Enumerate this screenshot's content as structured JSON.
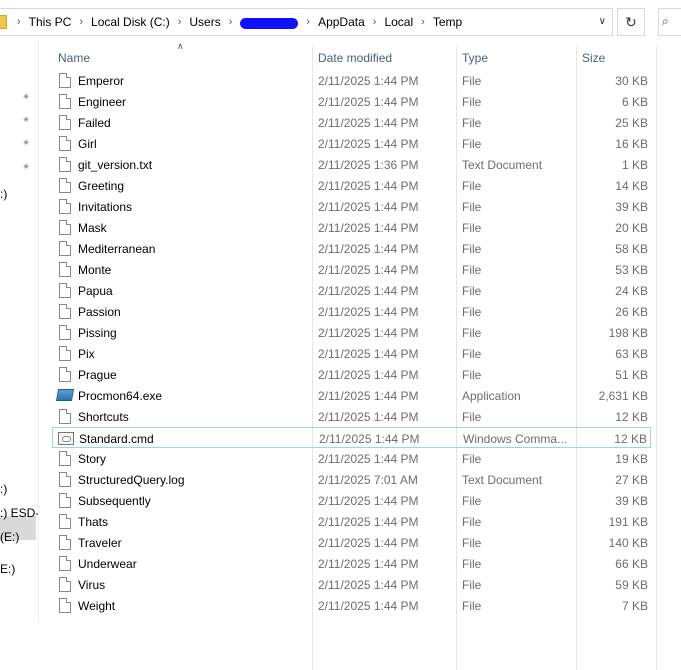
{
  "breadcrumb": [
    "This PC",
    "Local Disk (C:)",
    "Users",
    "AppData",
    "Local",
    "Temp"
  ],
  "icons": {
    "separator": "chevron-right-icon",
    "dropdown": "chevron-down-icon",
    "refresh": "refresh-icon",
    "search": "search-icon",
    "pin": "pin-icon"
  },
  "nav": {
    "labels": [
      ":)",
      ":)",
      ":) ESD-",
      "(E:)",
      "E:)"
    ]
  },
  "columns": {
    "name": "Name",
    "date": "Date modified",
    "type": "Type",
    "size": "Size"
  },
  "files": [
    {
      "name": "Emperor",
      "date": "2/11/2025 1:44 PM",
      "type": "File",
      "size": "30 KB",
      "icon": "file-icon"
    },
    {
      "name": "Engineer",
      "date": "2/11/2025 1:44 PM",
      "type": "File",
      "size": "6 KB",
      "icon": "file-icon"
    },
    {
      "name": "Failed",
      "date": "2/11/2025 1:44 PM",
      "type": "File",
      "size": "25 KB",
      "icon": "file-icon"
    },
    {
      "name": "Girl",
      "date": "2/11/2025 1:44 PM",
      "type": "File",
      "size": "16 KB",
      "icon": "file-icon"
    },
    {
      "name": "git_version.txt",
      "date": "2/11/2025 1:36 PM",
      "type": "Text Document",
      "size": "1 KB",
      "icon": "file-icon"
    },
    {
      "name": "Greeting",
      "date": "2/11/2025 1:44 PM",
      "type": "File",
      "size": "14 KB",
      "icon": "file-icon"
    },
    {
      "name": "Invitations",
      "date": "2/11/2025 1:44 PM",
      "type": "File",
      "size": "39 KB",
      "icon": "file-icon"
    },
    {
      "name": "Mask",
      "date": "2/11/2025 1:44 PM",
      "type": "File",
      "size": "20 KB",
      "icon": "file-icon"
    },
    {
      "name": "Mediterranean",
      "date": "2/11/2025 1:44 PM",
      "type": "File",
      "size": "58 KB",
      "icon": "file-icon"
    },
    {
      "name": "Monte",
      "date": "2/11/2025 1:44 PM",
      "type": "File",
      "size": "53 KB",
      "icon": "file-icon"
    },
    {
      "name": "Papua",
      "date": "2/11/2025 1:44 PM",
      "type": "File",
      "size": "24 KB",
      "icon": "file-icon"
    },
    {
      "name": "Passion",
      "date": "2/11/2025 1:44 PM",
      "type": "File",
      "size": "26 KB",
      "icon": "file-icon"
    },
    {
      "name": "Pissing",
      "date": "2/11/2025 1:44 PM",
      "type": "File",
      "size": "198 KB",
      "icon": "file-icon"
    },
    {
      "name": "Pix",
      "date": "2/11/2025 1:44 PM",
      "type": "File",
      "size": "63 KB",
      "icon": "file-icon"
    },
    {
      "name": "Prague",
      "date": "2/11/2025 1:44 PM",
      "type": "File",
      "size": "51 KB",
      "icon": "file-icon"
    },
    {
      "name": "Procmon64.exe",
      "date": "2/11/2025 1:44 PM",
      "type": "Application",
      "size": "2,631 KB",
      "icon": "application-icon"
    },
    {
      "name": "Shortcuts",
      "date": "2/11/2025 1:44 PM",
      "type": "File",
      "size": "12 KB",
      "icon": "file-icon"
    },
    {
      "name": "Standard.cmd",
      "date": "2/11/2025 1:44 PM",
      "type": "Windows Comma...",
      "size": "12 KB",
      "icon": "cmd-script-icon",
      "selected": true
    },
    {
      "name": "Story",
      "date": "2/11/2025 1:44 PM",
      "type": "File",
      "size": "19 KB",
      "icon": "file-icon"
    },
    {
      "name": "StructuredQuery.log",
      "date": "2/11/2025 7:01 AM",
      "type": "Text Document",
      "size": "27 KB",
      "icon": "file-icon"
    },
    {
      "name": "Subsequently",
      "date": "2/11/2025 1:44 PM",
      "type": "File",
      "size": "39 KB",
      "icon": "file-icon"
    },
    {
      "name": "Thats",
      "date": "2/11/2025 1:44 PM",
      "type": "File",
      "size": "191 KB",
      "icon": "file-icon"
    },
    {
      "name": "Traveler",
      "date": "2/11/2025 1:44 PM",
      "type": "File",
      "size": "140 KB",
      "icon": "file-icon"
    },
    {
      "name": "Underwear",
      "date": "2/11/2025 1:44 PM",
      "type": "File",
      "size": "66 KB",
      "icon": "file-icon"
    },
    {
      "name": "Virus",
      "date": "2/11/2025 1:44 PM",
      "type": "File",
      "size": "59 KB",
      "icon": "file-icon"
    },
    {
      "name": "Weight",
      "date": "2/11/2025 1:44 PM",
      "type": "File",
      "size": "7 KB",
      "icon": "file-icon"
    }
  ]
}
